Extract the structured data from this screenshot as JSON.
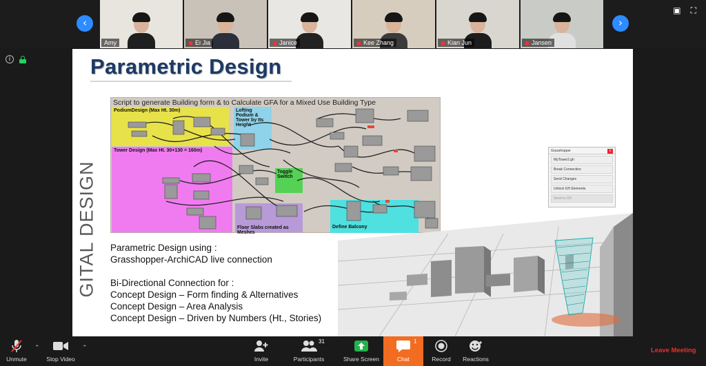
{
  "gallery": {
    "participants": [
      {
        "name": "Amy",
        "muted": false,
        "bg": "#e8e4de",
        "shirt": "#1f1f1f"
      },
      {
        "name": "Ei Jia",
        "muted": true,
        "bg": "#c9c2b9",
        "shirt": "#2a2f3a"
      },
      {
        "name": "Janice",
        "muted": true,
        "bg": "#e9e7e3",
        "shirt": "#222222"
      },
      {
        "name": "Kee Zhang",
        "muted": true,
        "bg": "#d7cdbf",
        "shirt": "#3a3a3a"
      },
      {
        "name": "Kian Jun",
        "muted": true,
        "bg": "#d9d6cf",
        "shirt": "#1d1d1d"
      },
      {
        "name": "Jansen",
        "muted": true,
        "bg": "#c9ccc6",
        "shirt": "#e0e0e0"
      }
    ]
  },
  "slide": {
    "title": "Parametric Design",
    "side_text": "GITAL DESIGN",
    "gh": {
      "caption": "Script to generate Building form & to Calculate GFA for a Mixed Use Building Type",
      "zones": {
        "podium": "PodiumDesign (Max Ht. 30m)",
        "tower": "Tower Design (Max Ht. 30+130 = 160m)",
        "lofting": "Lofting Podium & Tower by Its Height",
        "toggle": "Toggle Switch",
        "floor": "Floor Slabs created as Meshes",
        "balcony": "Define Balcony"
      }
    },
    "rhino_panel": {
      "title": "Grasshopper",
      "close": "x",
      "items": [
        "MyTower2.gh",
        "Break Connection",
        "Send Changes",
        "Unlock GH Elements",
        "Send to GH"
      ]
    },
    "lines": [
      "Parametric Design using :",
      "Grasshopper-ArchiCAD live connection",
      "",
      "Bi-Directional Connection for :",
      "Concept Design – Form finding & Alternatives",
      "Concept Design – Area Analysis",
      "Concept Design – Driven by Numbers (Ht., Stories)"
    ]
  },
  "toolbar": {
    "unmute": "Unmute",
    "stop_video": "Stop Video",
    "invite": "Invite",
    "participants": "Participants",
    "participants_count": "31",
    "share_screen": "Share Screen",
    "chat": "Chat",
    "chat_badge": "1",
    "record": "Record",
    "reactions": "Reactions",
    "leave": "Leave Meeting"
  },
  "colors": {
    "accent": "#2d8cff",
    "chat": "#f26d21",
    "leave": "#e8312f",
    "title": "#1f3864",
    "share": "#23b34a"
  }
}
